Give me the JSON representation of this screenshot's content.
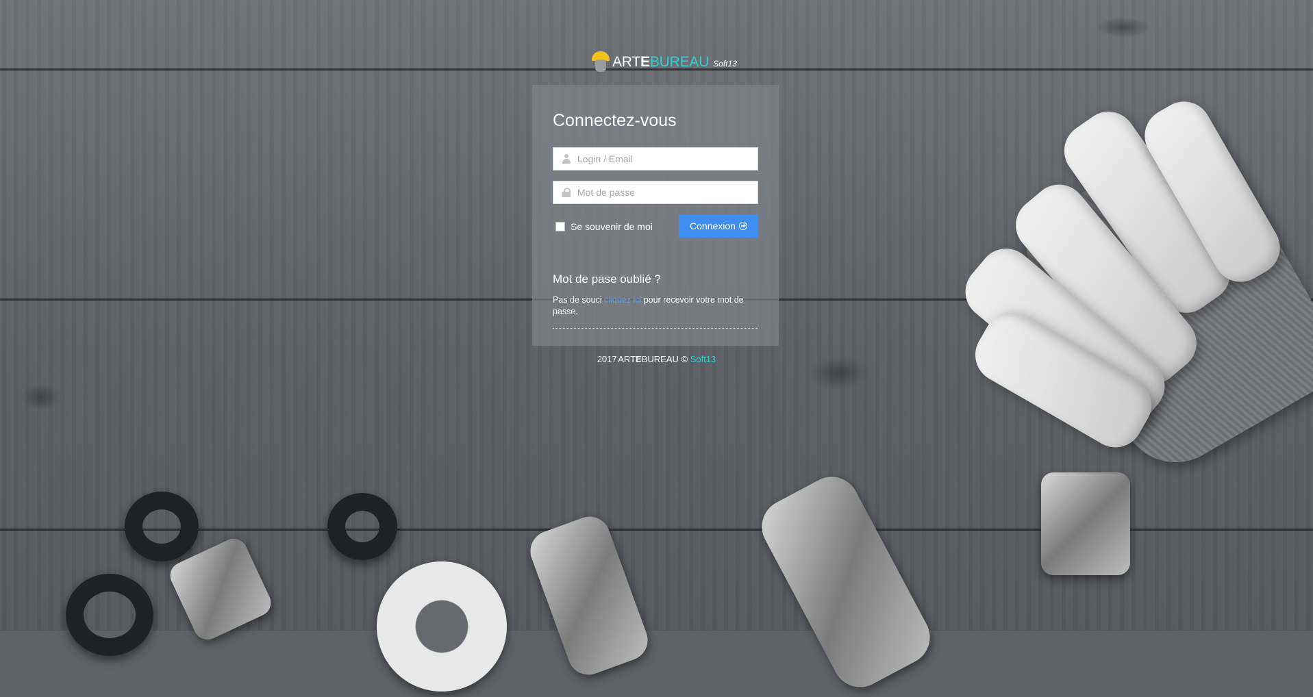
{
  "logo": {
    "brand_art": "ART",
    "brand_e": "E",
    "brand_bureau": "BUREAU",
    "soft": "Soft13"
  },
  "login": {
    "title": "Connectez-vous",
    "login_placeholder": "Login / Email",
    "password_placeholder": "Mot de passe",
    "remember_label": "Se souvenir de moi",
    "submit_label": "Connexion"
  },
  "forgot": {
    "title": "Mot de pase oublié ?",
    "text_before": "Pas de souci ",
    "link_text": "cliquez ici",
    "text_after": " pour recevoir votre mot de passe."
  },
  "footer": {
    "year": "2017",
    "brand_art": "ART",
    "brand_e": "E",
    "brand_bureau": "BUREAU ©",
    "soft_link": "Soft13"
  },
  "icons": {
    "user": "user-icon",
    "lock": "lock-icon",
    "submit": "arrow-circle-right-icon"
  },
  "colors": {
    "primary_button": "#3d8ef0",
    "brand_accent": "#2fd1cf",
    "link": "#5aa0ef"
  }
}
